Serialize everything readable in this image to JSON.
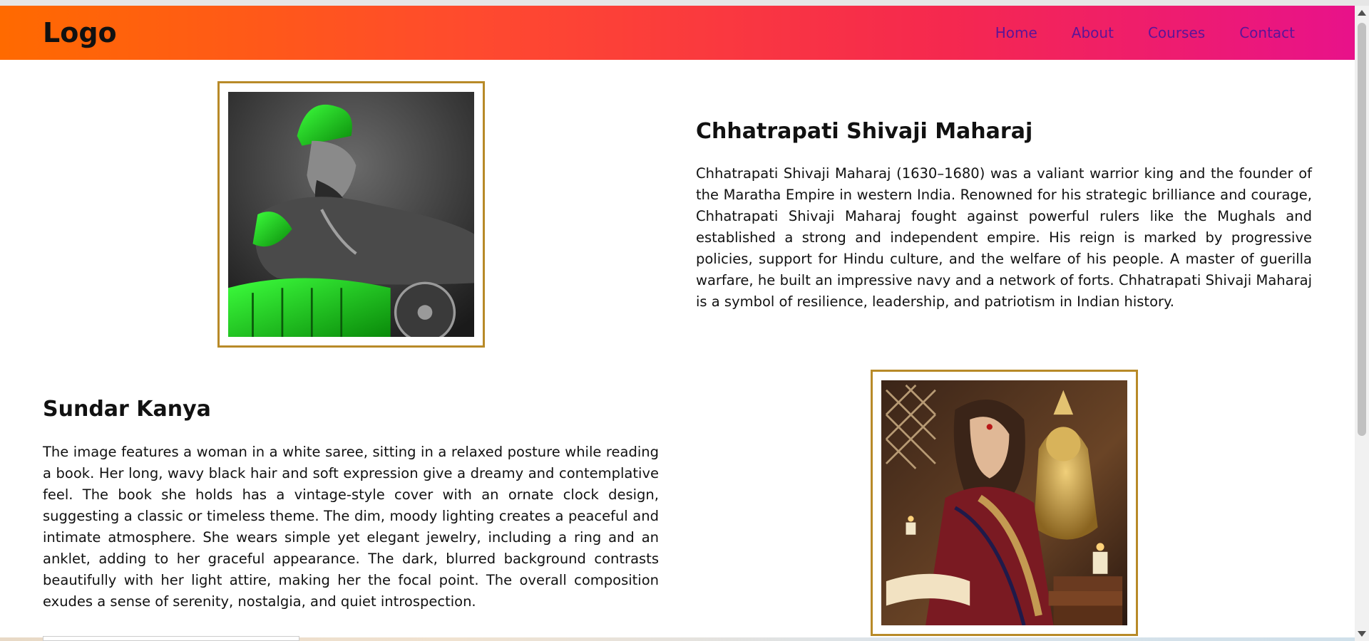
{
  "header": {
    "logo": "Logo",
    "nav": [
      "Home",
      "About",
      "Courses",
      "Contact"
    ]
  },
  "sections": [
    {
      "title": "Chhatrapati Shivaji Maharaj",
      "text": "Chhatrapati Shivaji Maharaj (1630–1680) was a valiant warrior king and the founder of the Maratha Empire in western India. Renowned for his strategic brilliance and courage, Chhatrapati Shivaji Maharaj fought against powerful rulers like the Mughals and established a strong and independent empire. His reign is marked by progressive policies, support for Hindu culture, and the welfare of his people. A master of guerilla warfare, he built an impressive navy and a network of forts. Chhatrapati Shivaji Maharaj is a symbol of resilience, leadership, and patriotism in Indian history."
    },
    {
      "title": "Sundar Kanya",
      "text": "The image features a woman in a white saree, sitting in a relaxed posture while reading a book. Her long, wavy black hair and soft expression give a dreamy and contemplative feel. The book she holds has a vintage-style cover with an ornate clock design, suggesting a classic or timeless theme. The dim, moody lighting creates a peaceful and intimate atmosphere. She wears simple yet elegant jewelry, including a ring and an anklet, adding to her graceful appearance. The dark, blurred background contrasts beautifully with her light attire, making her the focal point. The overall composition exudes a sense of serenity, nostalgia, and quiet introspection."
    }
  ],
  "colors": {
    "header_gradient": [
      "#ff6a00",
      "#e8128a"
    ],
    "nav_link": "#5b1598",
    "image_frame": "#b88a28"
  }
}
